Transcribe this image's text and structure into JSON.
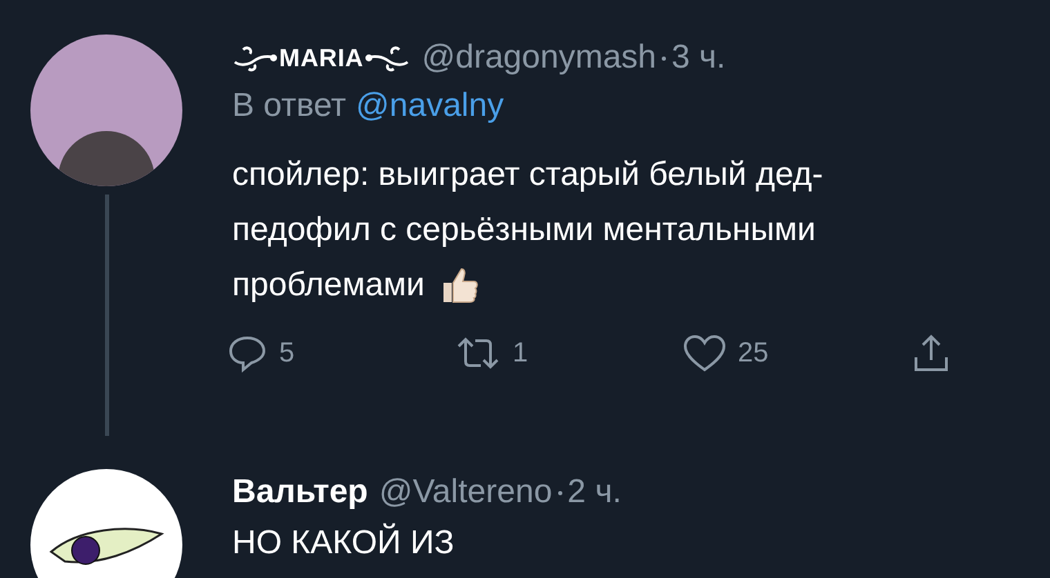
{
  "tweets": [
    {
      "kind": "reply_to",
      "display_name": "MARIA",
      "decorated": true,
      "handle": "@dragonymash",
      "time": "3 ч.",
      "reply_prefix": "В ответ",
      "reply_handle": "@navalny",
      "text": [
        "спойлер: выиграет старый белый дед-",
        "педофил с серьёзными ментальными",
        "проблемами"
      ],
      "thumbs_up": true,
      "thread_line": true,
      "actions": [
        {
          "kind": "reply",
          "count": "5"
        },
        {
          "kind": "retweet",
          "count": "1"
        },
        {
          "kind": "like",
          "count": "25"
        },
        {
          "kind": "share"
        }
      ]
    },
    {
      "kind": "plain",
      "display_name": "Вальтер",
      "decorated": false,
      "handle": "@Valtereno",
      "time": "2 ч.",
      "text": [
        "НО КАКОЙ ИЗ"
      ],
      "thumbs_up": false,
      "thread_line": false
    }
  ]
}
